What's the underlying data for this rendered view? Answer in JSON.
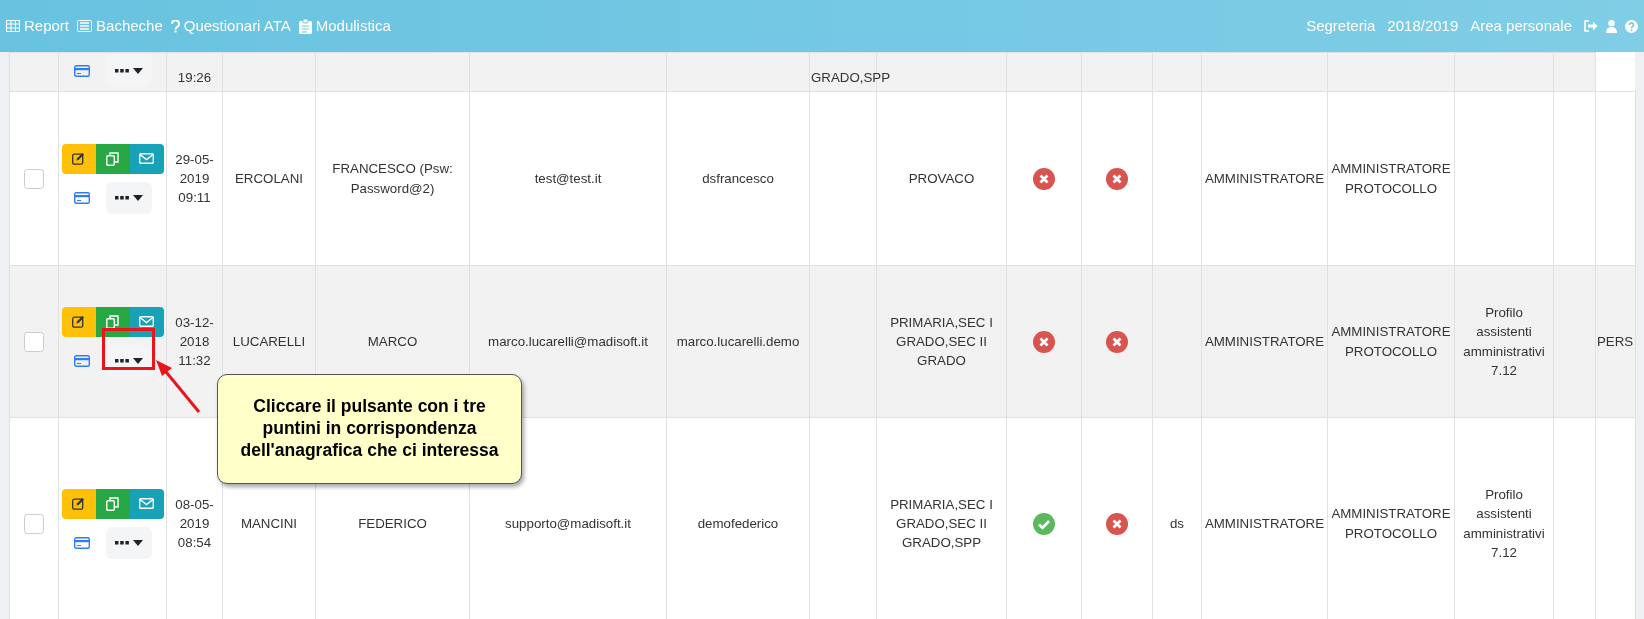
{
  "navbar": {
    "left_items": [
      {
        "kind": "grid",
        "label": "Report"
      },
      {
        "kind": "board",
        "label": "Bacheche"
      },
      {
        "kind": "question",
        "label": "Questionari ATA"
      },
      {
        "kind": "clipboard",
        "label": "Modulistica"
      }
    ],
    "right_items": [
      "Segreteria",
      "2018/2019",
      "Area personale"
    ]
  },
  "table": {
    "rows": [
      {
        "kind": "partial",
        "cells": [
          {
            "kind": "text",
            "text": "19:26"
          },
          {
            "kind": "empty"
          },
          {
            "kind": "empty"
          },
          {
            "kind": "empty"
          },
          {
            "kind": "empty"
          },
          {
            "kind": "text",
            "text": "GRADO,SPP"
          },
          {
            "kind": "empty"
          },
          {
            "kind": "empty"
          },
          {
            "kind": "empty"
          },
          {
            "kind": "empty"
          },
          {
            "kind": "empty"
          },
          {
            "kind": "empty"
          },
          {
            "kind": "empty"
          },
          {
            "kind": "empty"
          }
        ]
      },
      {
        "kind": "full",
        "checked": false,
        "cells": [
          {
            "kind": "text",
            "text": "29-05-2019 09:11"
          },
          {
            "kind": "text",
            "text": "ERCOLANI"
          },
          {
            "kind": "text",
            "text": "FRANCESCO (Psw: Password@2)"
          },
          {
            "kind": "text",
            "text": "test@test.it"
          },
          {
            "kind": "text",
            "text": "dsfrancesco"
          },
          {
            "kind": "empty"
          },
          {
            "kind": "text",
            "text": "PROVACO"
          },
          {
            "kind": "status",
            "ok": false
          },
          {
            "kind": "status",
            "ok": false
          },
          {
            "kind": "empty"
          },
          {
            "kind": "text",
            "text": "AMMINISTRATORE"
          },
          {
            "kind": "text",
            "text": "AMMINISTRATORE PROTOCOLLO"
          },
          {
            "kind": "empty"
          },
          {
            "kind": "empty"
          },
          {
            "kind": "empty"
          }
        ]
      },
      {
        "kind": "full",
        "checked": false,
        "cells": [
          {
            "kind": "text",
            "text": "03-12-2018 11:32"
          },
          {
            "kind": "text",
            "text": "LUCARELLI"
          },
          {
            "kind": "text",
            "text": "MARCO"
          },
          {
            "kind": "text",
            "text": "marco.lucarelli@madisoft.it"
          },
          {
            "kind": "text",
            "text": "marco.lucarelli.demo"
          },
          {
            "kind": "empty"
          },
          {
            "kind": "text",
            "text": "PRIMARIA,SEC I GRADO,SEC II GRADO"
          },
          {
            "kind": "status",
            "ok": false
          },
          {
            "kind": "status",
            "ok": false
          },
          {
            "kind": "empty"
          },
          {
            "kind": "text",
            "text": "AMMINISTRATORE"
          },
          {
            "kind": "text",
            "text": "AMMINISTRATORE PROTOCOLLO"
          },
          {
            "kind": "text",
            "text": "Profilo assistenti amministrativi 7.12"
          },
          {
            "kind": "empty"
          },
          {
            "kind": "text",
            "text": "PERS"
          }
        ]
      },
      {
        "kind": "full",
        "checked": false,
        "cells": [
          {
            "kind": "text",
            "text": "08-05-2019 08:54"
          },
          {
            "kind": "text",
            "text": "MANCINI"
          },
          {
            "kind": "text",
            "text": "FEDERICO"
          },
          {
            "kind": "text",
            "text": "supporto@madisoft.it"
          },
          {
            "kind": "text",
            "text": "demofederico"
          },
          {
            "kind": "empty"
          },
          {
            "kind": "text",
            "text": "PRIMARIA,SEC I GRADO,SEC II GRADO,SPP"
          },
          {
            "kind": "status",
            "ok": true
          },
          {
            "kind": "status",
            "ok": false
          },
          {
            "kind": "text",
            "text": "ds"
          },
          {
            "kind": "text",
            "text": "AMMINISTRATORE"
          },
          {
            "kind": "text",
            "text": "AMMINISTRATORE PROTOCOLLO"
          },
          {
            "kind": "text",
            "text": "Profilo assistenti amministrativi 7.12"
          },
          {
            "kind": "empty"
          },
          {
            "kind": "empty"
          }
        ]
      }
    ]
  },
  "callout": {
    "text": "Cliccare il pulsante con i tre puntini in corrispondenza dell'anagrafica che ci interessa"
  }
}
